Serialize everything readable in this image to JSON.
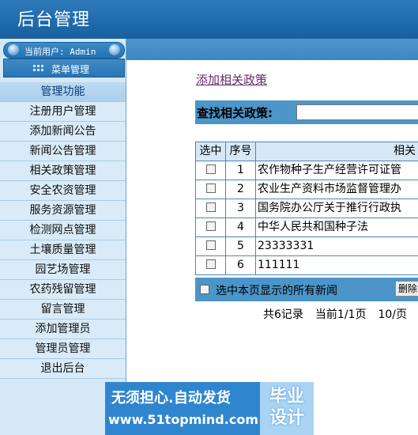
{
  "header": {
    "title": "后台管理"
  },
  "sidebar": {
    "user_label": "当前用户: Admin",
    "menu_label": "菜单管理",
    "nav_heading": "管理功能",
    "items": [
      {
        "label": "注册用户管理"
      },
      {
        "label": "添加新闻公告"
      },
      {
        "label": "新闻公告管理"
      },
      {
        "label": "相关政策管理"
      },
      {
        "label": "安全农资管理"
      },
      {
        "label": "服务资源管理"
      },
      {
        "label": "检测网点管理"
      },
      {
        "label": "土壤质量管理"
      },
      {
        "label": "园艺场管理"
      },
      {
        "label": "农药残留管理"
      },
      {
        "label": "留言管理"
      },
      {
        "label": "添加管理员"
      },
      {
        "label": "管理员管理"
      },
      {
        "label": "退出后台"
      }
    ]
  },
  "main": {
    "add_link": "添加相关政策",
    "search": {
      "label": "查找相关政策:",
      "value": ""
    },
    "table": {
      "columns": [
        "选中",
        "序号",
        "相关"
      ],
      "rows": [
        {
          "no": "1",
          "title": "农作物种子生产经营许可证管"
        },
        {
          "no": "2",
          "title": "农业生产资料市场监督管理办"
        },
        {
          "no": "3",
          "title": "国务院办公厅关于推行行政执"
        },
        {
          "no": "4",
          "title": "中华人民共和国种子法"
        },
        {
          "no": "5",
          "title": "23333331"
        },
        {
          "no": "6",
          "title": "111111"
        }
      ]
    },
    "select_all_label": "选中本页显示的所有新闻",
    "delete_label": "删除",
    "pager": {
      "total": "共6记录",
      "current": "当前1/1页",
      "per_page": "10/页"
    }
  },
  "watermark": {
    "line1": "无须担心.自动发货",
    "line2": "www.51topmind.com",
    "badge": "毕业设计"
  }
}
